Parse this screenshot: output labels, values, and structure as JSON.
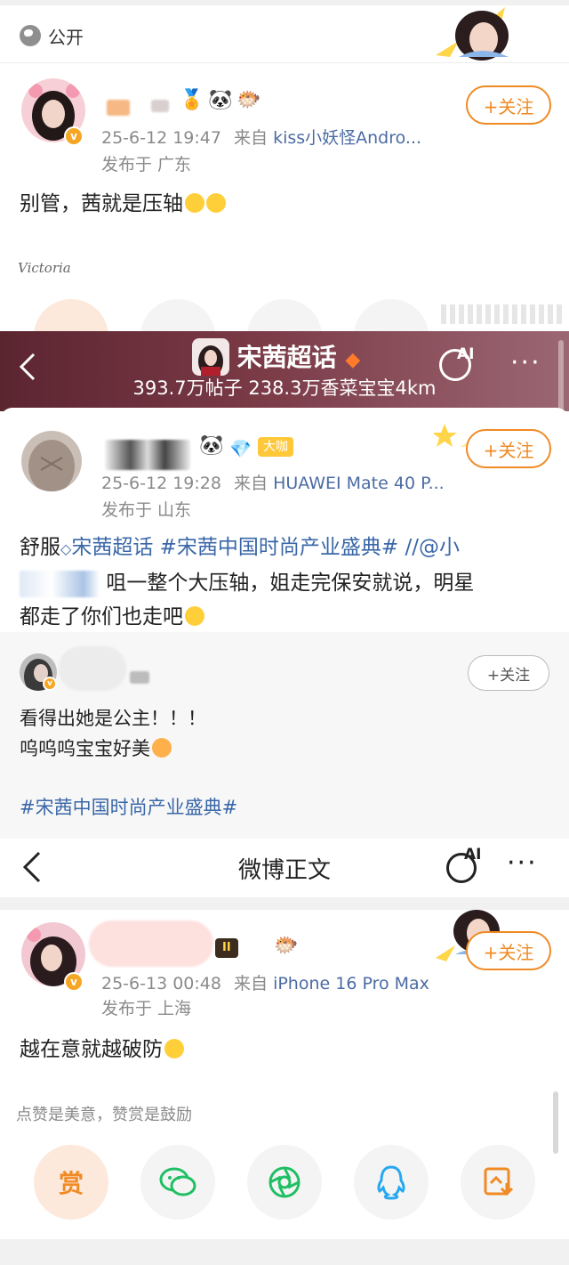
{
  "section1": {
    "visibility": "公开",
    "meta_time": "25-6-12 19:47",
    "meta_from": "来自",
    "meta_source": "kiss小妖怪Andro...",
    "meta_location": "发布于 广东",
    "follow_label": "+关注",
    "post_text": "别管，茜就是压轴",
    "signature": "Victoria"
  },
  "topic": {
    "title": "宋茜超话",
    "stats": "393.7万帖子 238.3万香菜宝宝4km"
  },
  "section2": {
    "meta_time": "25-6-12 19:28",
    "meta_from": "来自",
    "meta_source": "HUAWEI Mate 40 P...",
    "meta_location": "发布于 山东",
    "follow_label": "+关注",
    "badge_label": "大咖",
    "post_line1_a": "舒服",
    "post_line1_tag1": "宋茜超话",
    "post_line1_tag2": "#宋茜中国时尚产业盛典#",
    "post_line1_b": "//@小",
    "post_line2": "咀一整个大压轴，姐走完保安就说，明星",
    "post_line3": "都走了你们也走吧",
    "repost_follow": "+关注",
    "repost_line1": "看得出她是公主！！！",
    "repost_line2": "呜呜呜宝宝好美",
    "repost_tag": "#宋茜中国时尚产业盛典#"
  },
  "section3": {
    "nav_title": "微博正文",
    "ai_label": "AI",
    "meta_time": "25-6-13 00:48",
    "meta_from": "来自",
    "meta_source": "iPhone 16 Pro Max",
    "meta_location": "发布于 上海",
    "follow_label": "+关注",
    "level_badge": "II",
    "post_text": "越在意就越破防",
    "tip": "点赞是美意，赞赏是鼓励",
    "reward_label": "赏"
  },
  "colors": {
    "accent_orange": "#f08a24",
    "link_blue": "#3a67a8",
    "topic_bg": "#6b2f3b"
  }
}
